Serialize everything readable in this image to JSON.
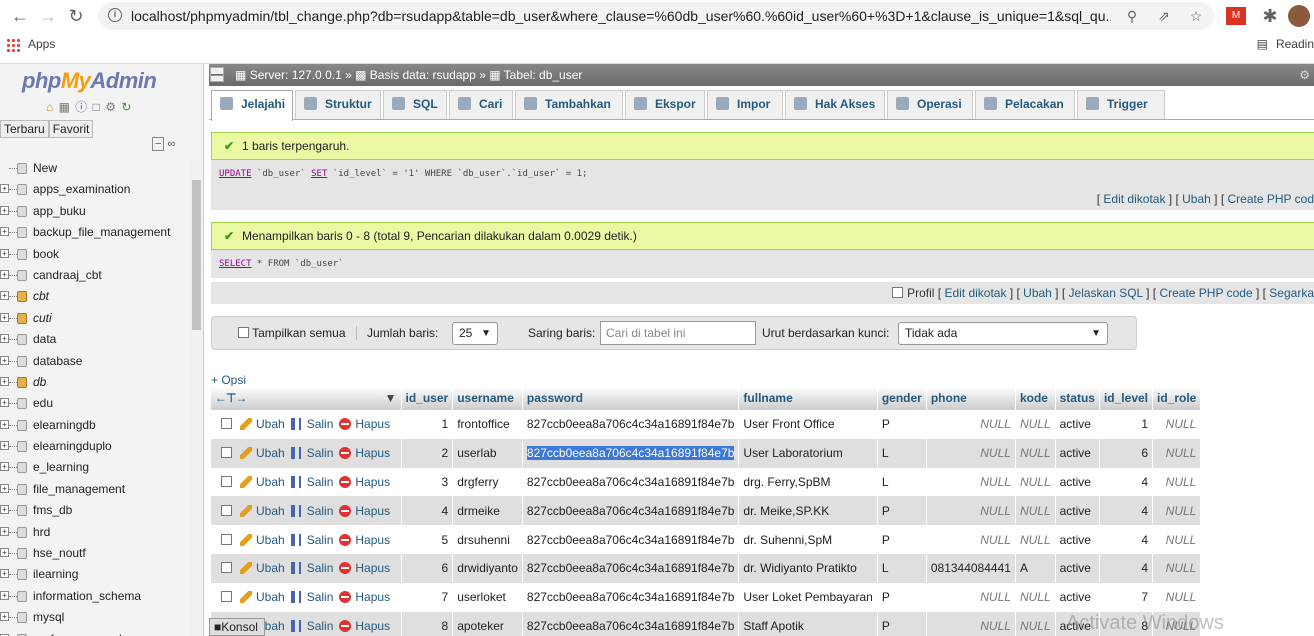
{
  "browser": {
    "url": "localhost/phpmyadmin/tbl_change.php?db=rsudapp&table=db_user&where_clause=%60db_user%60.%60id_user%60+%3D+1&clause_is_unique=1&sql_qu...",
    "bookmark_apps": "Apps",
    "bookmark_reading": "Readin"
  },
  "nav": {
    "logo_php": "php",
    "logo_my": "My",
    "logo_admin": "Admin",
    "tab_recent": "Terbaru",
    "tab_favorite": "Favorit",
    "databases": [
      {
        "name": "New",
        "italic": false,
        "group": false
      },
      {
        "name": "apps_examination",
        "italic": false,
        "group": false
      },
      {
        "name": "app_buku",
        "italic": false,
        "group": false
      },
      {
        "name": "backup_file_management",
        "italic": false,
        "group": false
      },
      {
        "name": "book",
        "italic": false,
        "group": false
      },
      {
        "name": "candraaj_cbt",
        "italic": false,
        "group": false
      },
      {
        "name": "cbt",
        "italic": true,
        "group": true
      },
      {
        "name": "cuti",
        "italic": true,
        "group": true
      },
      {
        "name": "data",
        "italic": false,
        "group": false
      },
      {
        "name": "database",
        "italic": false,
        "group": false
      },
      {
        "name": "db",
        "italic": true,
        "group": true
      },
      {
        "name": "edu",
        "italic": false,
        "group": false
      },
      {
        "name": "elearningdb",
        "italic": false,
        "group": false
      },
      {
        "name": "elearningduplo",
        "italic": false,
        "group": false
      },
      {
        "name": "e_learning",
        "italic": false,
        "group": false
      },
      {
        "name": "file_management",
        "italic": false,
        "group": false
      },
      {
        "name": "fms_db",
        "italic": false,
        "group": false
      },
      {
        "name": "hrd",
        "italic": false,
        "group": false
      },
      {
        "name": "hse_noutf",
        "italic": false,
        "group": false
      },
      {
        "name": "ilearning",
        "italic": false,
        "group": false
      },
      {
        "name": "information_schema",
        "italic": false,
        "group": false
      },
      {
        "name": "mysql",
        "italic": false,
        "group": false
      },
      {
        "name": "performance_schema",
        "italic": false,
        "group": false
      }
    ]
  },
  "breadcrumb": {
    "server": "Server: 127.0.0.1",
    "database": "Basis data: rsudapp",
    "table": "Tabel: db_user"
  },
  "tabs": [
    "Jelajahi",
    "Struktur",
    "SQL",
    "Cari",
    "Tambahkan",
    "Ekspor",
    "Impor",
    "Hak Akses",
    "Operasi",
    "Pelacakan",
    "Trigger"
  ],
  "update_msg": {
    "text": "1 baris terpengaruh.",
    "sql_kw1": "UPDATE",
    "sql_a": " `db_user` ",
    "sql_kw2": "SET",
    "sql_b": " `id_level` = '1' WHERE `db_user`.`id_user` = 1;",
    "link_edit_inline": "Edit dikotak",
    "link_edit": "Ubah",
    "link_php": "Create PHP cod"
  },
  "select_msg": {
    "text": "Menampilkan baris 0 - 8 (total 9, Pencarian dilakukan dalam 0.0029 detik.)",
    "sql_kw": "SELECT",
    "sql_rest": " * FROM `db_user`",
    "profil": "Profil",
    "link_edit_inline": "Edit dikotak",
    "link_edit": "Ubah",
    "link_explain": "Jelaskan SQL",
    "link_php": "Create PHP code",
    "link_refresh": "Segarka"
  },
  "navbar": {
    "show_all": "Tampilkan semua",
    "rows_label": "Jumlah baris:",
    "rows_value": "25",
    "filter_label": "Saring baris:",
    "filter_placeholder": "Cari di tabel ini",
    "sort_label": "Urut berdasarkan kunci:",
    "sort_value": "Tidak ada"
  },
  "opsi": "+ Opsi",
  "actions": {
    "edit": "Ubah",
    "copy": "Salin",
    "delete": "Hapus"
  },
  "columns": [
    "id_user",
    "username",
    "password",
    "fullname",
    "gender",
    "phone",
    "kode",
    "status",
    "id_level",
    "id_role"
  ],
  "rows": [
    [
      "1",
      "frontoffice",
      "827ccb0eea8a706c4c34a16891f84e7b",
      "User Front Office",
      "P",
      "NULL",
      "NULL",
      "active",
      "1",
      "NULL"
    ],
    [
      "2",
      "userlab",
      "827ccb0eea8a706c4c34a16891f84e7b",
      "User Laboratorium",
      "L",
      "NULL",
      "NULL",
      "active",
      "6",
      "NULL"
    ],
    [
      "3",
      "drgferry",
      "827ccb0eea8a706c4c34a16891f84e7b",
      "drg. Ferry,SpBM",
      "L",
      "NULL",
      "NULL",
      "active",
      "4",
      "NULL"
    ],
    [
      "4",
      "drmeike",
      "827ccb0eea8a706c4c34a16891f84e7b",
      "dr. Meike,SP.KK",
      "P",
      "NULL",
      "NULL",
      "active",
      "4",
      "NULL"
    ],
    [
      "5",
      "drsuhenni",
      "827ccb0eea8a706c4c34a16891f84e7b",
      "dr. Suhenni,SpM",
      "P",
      "NULL",
      "NULL",
      "active",
      "4",
      "NULL"
    ],
    [
      "6",
      "drwidiyanto",
      "827ccb0eea8a706c4c34a16891f84e7b",
      "dr. Widiyanto Pratikto",
      "L",
      "081344084441",
      "A",
      "active",
      "4",
      "NULL"
    ],
    [
      "7",
      "userloket",
      "827ccb0eea8a706c4c34a16891f84e7b",
      "User Loket Pembayaran",
      "P",
      "NULL",
      "NULL",
      "active",
      "7",
      "NULL"
    ],
    [
      "8",
      "apoteker",
      "827ccb0eea8a706c4c34a16891f84e7b",
      "Staff Apotik",
      "P",
      "NULL",
      "NULL",
      "active",
      "8",
      "NULL"
    ]
  ],
  "console": "Konsol",
  "watermark": "Activate Windows"
}
